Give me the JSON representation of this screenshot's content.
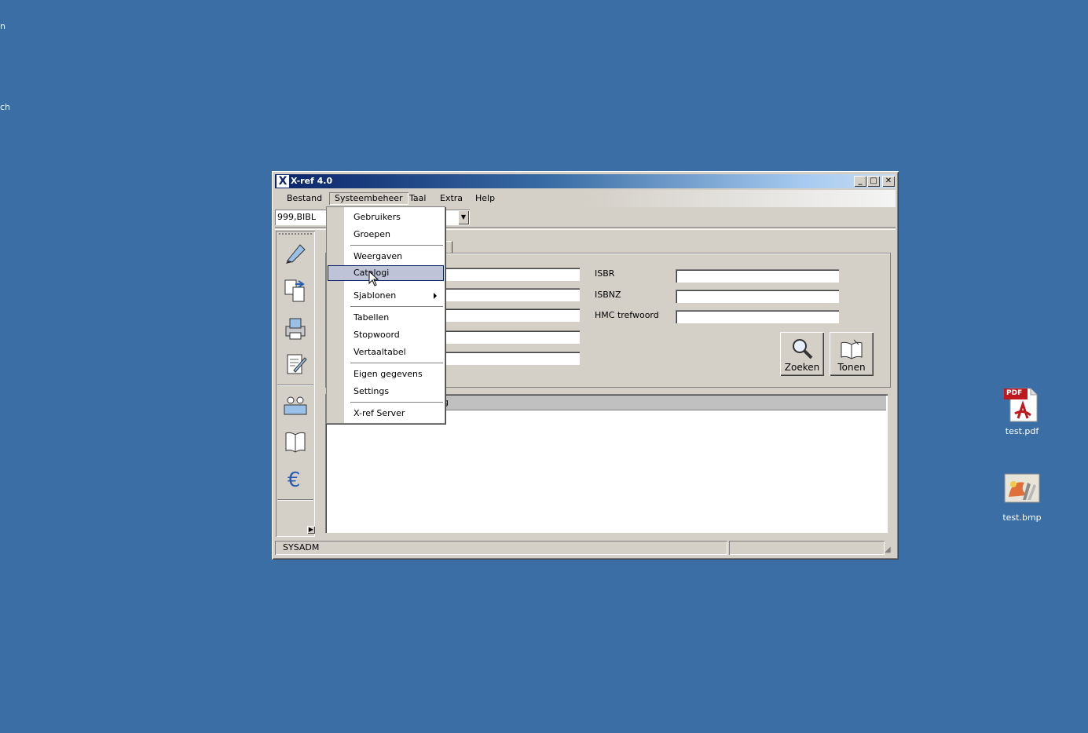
{
  "desktop": {
    "frag_top": "n",
    "frag_mid": "ch",
    "icons": [
      {
        "label": "test.pdf",
        "icon": "pdf-file-icon",
        "badge": "PDF"
      },
      {
        "label": "test.bmp",
        "icon": "bitmap-file-icon"
      }
    ]
  },
  "window": {
    "title": "X-ref 4.0",
    "app_icon_glyph": "X",
    "controls": {
      "minimize": "_",
      "maximize": "□",
      "close": "✕"
    },
    "menu": [
      "Bestand",
      "Systeembeheer",
      "Taal",
      "Extra",
      "Help"
    ],
    "active_menu": "Systeembeheer",
    "combo_value": "999,BIBL",
    "tab_fragment": "n",
    "fields_right": [
      {
        "label": "ISBR",
        "value": ""
      },
      {
        "label": "ISBNZ",
        "value": ""
      },
      {
        "label": "HMC trefwoord",
        "value": ""
      }
    ],
    "buttons": {
      "search": "Zoeken",
      "show": "Tonen"
    },
    "grid_header_fragment": "g",
    "status": {
      "user": "SYSADM",
      "right": ""
    }
  },
  "dropdown": {
    "items": [
      {
        "label": "Gebruikers"
      },
      {
        "label": "Groepen"
      },
      {
        "label": "Weergaven"
      },
      {
        "label": "Catalogi",
        "selected": true
      },
      {
        "label": "Sjablonen",
        "submenu": true
      },
      {
        "label": "Tabellen"
      },
      {
        "label": "Stopwoord"
      },
      {
        "label": "Vertaaltabel"
      },
      {
        "label": "Eigen gegevens"
      },
      {
        "label": "Settings"
      },
      {
        "label": "X-ref Server"
      }
    ]
  },
  "colors": {
    "desktop": "#3a6ea5",
    "title_start": "#0a246a",
    "selection": "#bec3d8",
    "face": "#d4d0c8"
  },
  "sidebar_icons": [
    "pencil-icon",
    "documents-icon",
    "printer-icon",
    "edit-document-icon",
    "users-icon",
    "book-icon",
    "euro-icon"
  ]
}
